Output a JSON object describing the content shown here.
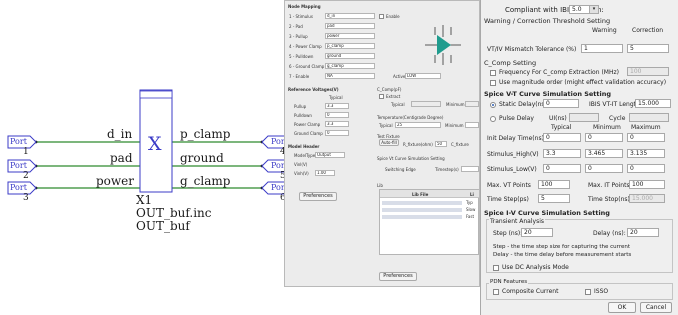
{
  "schematic": {
    "ports": {
      "left": [
        "Port",
        "Port",
        "Port"
      ],
      "right": [
        "Port",
        "Port",
        "Port"
      ]
    },
    "pin_numbers": [
      "1",
      "2",
      "3",
      "4",
      "5",
      "6"
    ],
    "net_labels": {
      "d_in": "d_in",
      "pad": "pad",
      "power": "power",
      "p_clamp": "p_clamp",
      "ground": "ground",
      "g_clamp": "g_clamp"
    },
    "component": {
      "symbol": "X",
      "refdes": "X1",
      "file": "OUT_buf.inc",
      "model": "OUT_buf"
    }
  },
  "back_dialog": {
    "node_mapping_title": "Node Mapping",
    "enable_label": "Enable",
    "rows": [
      {
        "label": "1 - Stimulus",
        "value": "d_in"
      },
      {
        "label": "2 - Pad",
        "value": "pad"
      },
      {
        "label": "3 - Pullup",
        "value": "power"
      },
      {
        "label": "4 - Power Clamp",
        "value": "p_clamp"
      },
      {
        "label": "5 - Pulldown",
        "value": "ground"
      },
      {
        "label": "6 - Ground Clamp",
        "value": "g_clamp"
      },
      {
        "label": "7 - Enable",
        "value": "NA"
      }
    ],
    "active_label": "Active",
    "active_value": "LOW",
    "ref_voltages_title": "Reference Voltages(V)",
    "typical_label": "Typical",
    "pullup_label": "Pullup",
    "pullup_value": "3.3",
    "pulldown_label": "Pulldown",
    "pulldown_value": "0",
    "powerclamp_label": "Power Clamp",
    "powerclamp_value": "3.3",
    "groundclamp_label": "Ground Clamp",
    "groundclamp_value": "0",
    "model_header_title": "Model Header",
    "modeltype_label": "ModelType",
    "modeltype_value": "Output",
    "vinl_label": "Vinl(V)",
    "vinh_label": "Vinh(V)",
    "vinh_value": "1.00",
    "ccomp_title": "C_Comp(pF)",
    "extract_label": "Extract",
    "typical_col": "Typical",
    "minimum_col": "Minimum",
    "temp_title": "Temperature(Centigrade Degree)",
    "temp_typical": "Typical",
    "temp_value": "25",
    "temp_min": "Minimum",
    "test_fixture_title": "Test Fixture",
    "autofill_label": "Auto-fill",
    "rfixture_label": "R_fixture(ohm)",
    "rfixture_value": "50",
    "cfixture_label": "C_fixture",
    "spice_vt_title": "Spice Vt Curve Simulation Setting",
    "switching_label": "Switching Edge",
    "timestep_label": "Timestep(s)",
    "lib_title": "Lib",
    "lib_file_col": "Lib File",
    "lib_col2": "Li",
    "lib_rows": [
      "Typ",
      "Slow",
      "Fast"
    ],
    "preferences_btn": "Preferences"
  },
  "front_dialog": {
    "compliant_label": "Compliant with IBIS Version:",
    "ibis_version": "5.0",
    "warn_section": "Warning / Correction Threshold Setting",
    "warning_col": "Warning",
    "correction_col": "Correction",
    "mismatch_label": "VT/IV Mismatch Tolerance (%)",
    "mismatch_warning": "1",
    "mismatch_correction": "5",
    "ccomp_section": "C_Comp Setting",
    "freq_label": "Frequency For C_comp Extraction (MHz)",
    "freq_value": "100",
    "magnitude_label": "Use magnitude order (might effect validation accuracy)",
    "vt_section": "Spice V-T Curve Simulation Setting",
    "static_delay_label": "Static Delay(ns)",
    "static_delay_value": "0",
    "ibis_len_label": "IBIS VT-IT Length(ns)",
    "ibis_len_value": "15.000",
    "pulse_delay_label": "Pulse Delay",
    "ui_label": "UI(ns)",
    "cycle_label": "Cycle",
    "typical_col": "Typical",
    "minimum_col": "Minimum",
    "maximum_col": "Maximum",
    "init_delay_label": "Init Delay Time(ns)",
    "init_delay": [
      "0",
      "0",
      "0"
    ],
    "stim_high_label": "Stimulus_High(V)",
    "stim_high": [
      "3.3",
      "3.465",
      "3.135"
    ],
    "stim_low_label": "Stimulus_Low(V)",
    "stim_low": [
      "0",
      "0",
      "0"
    ],
    "max_vt_label": "Max. VT Points",
    "max_vt_value": "100",
    "max_it_label": "Max. IT Points",
    "max_it_value": "100",
    "time_step_label": "Time Step(ps)",
    "time_step_value": "5",
    "time_stop_label": "Time Stop(ns)",
    "time_stop_value": "15.000",
    "iv_section": "Spice I-V Curve Simulation Setting",
    "transient_section": "Transient Analysis",
    "step_label": "Step (ns):",
    "step_value": "20",
    "delay_label": "Delay (ns):",
    "delay_value": "20",
    "hint_line1": "Step - the time step size for capturing the current",
    "hint_line2": "Delay - the time delay before measurement starts",
    "dc_label": "Use DC Analysis Mode",
    "pdn_section": "PDN Features",
    "composite_label": "Composite Current",
    "isso_label": "ISSO",
    "ok_btn": "OK",
    "cancel_btn": "Cancel"
  }
}
